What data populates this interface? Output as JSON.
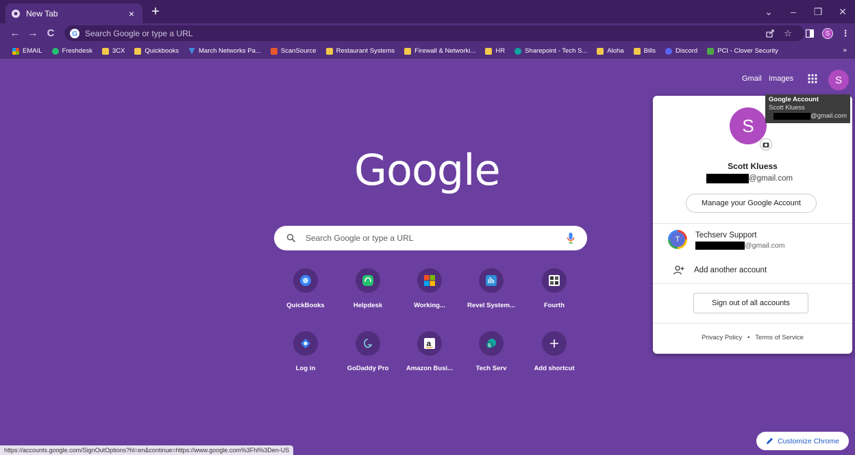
{
  "tab": {
    "title": "New Tab",
    "close": "×",
    "new": "+"
  },
  "window": {
    "dropdown": "⌄",
    "minimize": "–",
    "restore": "❐",
    "close": "✕"
  },
  "toolbar": {
    "back": "←",
    "forward": "→",
    "reload": "C",
    "omnibox_placeholder": "Search Google or type a URL",
    "profile_initial": "S"
  },
  "bookmarks": [
    {
      "label": "EMAIL",
      "icon": "microsoft-icon"
    },
    {
      "label": "Freshdesk",
      "icon": "freshdesk-icon"
    },
    {
      "label": "3CX",
      "icon": "folder-icon"
    },
    {
      "label": "Quickbooks",
      "icon": "folder-icon"
    },
    {
      "label": "March Networks Pa...",
      "icon": "march-networks-icon"
    },
    {
      "label": "ScanSource",
      "icon": "scansource-icon"
    },
    {
      "label": "Restaurant Systems",
      "icon": "folder-icon"
    },
    {
      "label": "Firewall & Networki...",
      "icon": "folder-icon"
    },
    {
      "label": "HR",
      "icon": "folder-icon"
    },
    {
      "label": "Sharepoint - Tech S...",
      "icon": "sharepoint-icon"
    },
    {
      "label": "Aloha",
      "icon": "folder-icon"
    },
    {
      "label": "Bills",
      "icon": "folder-icon"
    },
    {
      "label": "Discord",
      "icon": "discord-icon"
    },
    {
      "label": "PCI - Clover Security",
      "icon": "clover-icon"
    }
  ],
  "bookmarks_more": "»",
  "header": {
    "gmail": "Gmail",
    "images": "Images",
    "avatar_initial": "S"
  },
  "logo": "Google",
  "search": {
    "placeholder": "Search Google or type a URL"
  },
  "shortcuts": [
    {
      "label": "QuickBooks",
      "icon": "quickbooks-icon"
    },
    {
      "label": "Helpdesk",
      "icon": "helpdesk-icon"
    },
    {
      "label": "Working...",
      "icon": "microsoft-icon"
    },
    {
      "label": "Revel System...",
      "icon": "revel-icon"
    },
    {
      "label": "Fourth",
      "icon": "fourth-icon"
    },
    {
      "label": "Log in",
      "icon": "login-icon"
    },
    {
      "label": "GoDaddy Pro",
      "icon": "godaddy-icon"
    },
    {
      "label": "Amazon Busi...",
      "icon": "amazon-icon"
    },
    {
      "label": "Tech Serv",
      "icon": "sharepoint-icon"
    },
    {
      "label": "Add shortcut",
      "icon": "plus-icon"
    }
  ],
  "account_popup": {
    "avatar_initial": "S",
    "name": "Scott Kluess",
    "email_suffix": "@gmail.com",
    "manage_label": "Manage your Google Account",
    "other_account": {
      "initial": "T",
      "name": "Techserv Support",
      "email_suffix": "@gmail.com"
    },
    "add_account_label": "Add another account",
    "signout_label": "Sign out of all accounts",
    "privacy": "Privacy Policy",
    "separator": "•",
    "terms": "Terms of Service"
  },
  "tooltip": {
    "title": "Google Account",
    "name": "Scott Kluess",
    "email_suffix": "@gmail.com"
  },
  "statusbar": "https://accounts.google.com/SignOutOptions?hl=en&continue=https://www.google.com%3Fhl%3Den-US",
  "customize_label": "Customize Chrome",
  "colors": {
    "background": "#6b3fa0",
    "tabstrip": "#3d1f5f",
    "toolbar": "#512d7d",
    "avatar": "#b04ac0",
    "link_blue": "#1a56c7"
  }
}
